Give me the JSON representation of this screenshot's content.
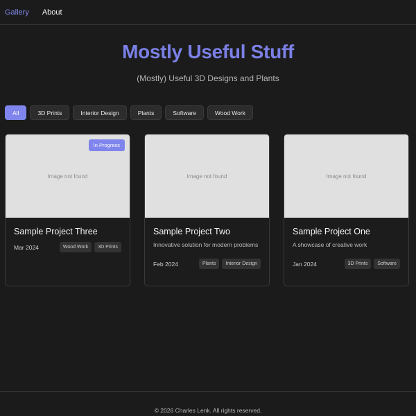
{
  "nav": {
    "items": [
      {
        "label": "Gallery",
        "active": true
      },
      {
        "label": "About",
        "active": false
      }
    ]
  },
  "hero": {
    "title": "Mostly Useful Stuff",
    "subtitle": "(Mostly) Useful 3D Designs and Plants"
  },
  "filters": [
    "All",
    "3D Prints",
    "Interior Design",
    "Plants",
    "Software",
    "Wood Work"
  ],
  "active_filter": "All",
  "cards": [
    {
      "image_text": "Image not found",
      "badge": "In Progress",
      "title": "Sample Project Three",
      "description": "",
      "date": "Mar 2024",
      "tags": [
        "Wood Work",
        "3D Prints"
      ]
    },
    {
      "image_text": "Image not found",
      "badge": "",
      "title": "Sample Project Two",
      "description": "Innovative solution for modern problems",
      "date": "Feb 2024",
      "tags": [
        "Plants",
        "Interior Design"
      ]
    },
    {
      "image_text": "Image not found",
      "badge": "",
      "title": "Sample Project One",
      "description": "A showcase of creative work",
      "date": "Jan 2024",
      "tags": [
        "3D Prints",
        "Software"
      ]
    }
  ],
  "footer": {
    "text": "© 2026 Charles Lenk. All rights reserved."
  },
  "colors": {
    "accent": "#7f85ec",
    "background": "#1b1b1b",
    "card_border": "#3a3a3a"
  }
}
